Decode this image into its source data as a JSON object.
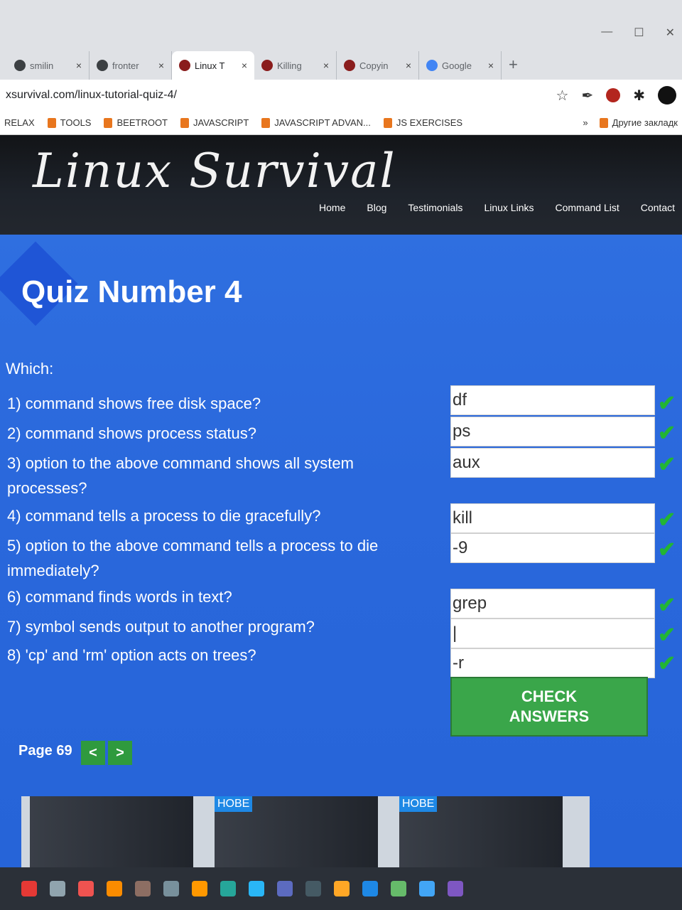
{
  "browser": {
    "tabs": [
      {
        "label": "smilin",
        "active": false
      },
      {
        "label": "fronter",
        "active": false
      },
      {
        "label": "Linux T",
        "active": true
      },
      {
        "label": "Killing",
        "active": false
      },
      {
        "label": "Copyin",
        "active": false
      },
      {
        "label": "Google",
        "active": false
      }
    ],
    "close_glyph": "×",
    "new_tab": "+",
    "url": "xsurvival.com/linux-tutorial-quiz-4/",
    "bookmarks": [
      "RELAX",
      "TOOLS",
      "BEETROOT",
      "JAVASCRIPT",
      "JAVASCRIPT ADVAN...",
      "JS EXERCISES"
    ],
    "bookmarks_more": "»",
    "other_bookmarks": "Другие закладк"
  },
  "site": {
    "logo": "Linux Survival",
    "nav": [
      "Home",
      "Blog",
      "Testimonials",
      "Linux Links",
      "Command List",
      "Contact"
    ]
  },
  "quiz": {
    "title": "Quiz Number 4",
    "intro": "Which:",
    "questions": [
      {
        "line1": "1) command shows free disk space?",
        "line2": "",
        "answer": "df"
      },
      {
        "line1": "2) command shows process status?",
        "line2": "",
        "answer": "ps"
      },
      {
        "line1": "3) option to the above command shows all system",
        "line2": "processes?",
        "answer": "aux"
      },
      {
        "line1": "4) command tells a process to die gracefully?",
        "line2": "",
        "answer": "kill"
      },
      {
        "line1": "5) option to the above command tells a process to die",
        "line2": "immediately?",
        "answer": "-9"
      },
      {
        "line1": "6) command finds words in text?",
        "line2": "",
        "answer": "grep"
      },
      {
        "line1": "7) symbol sends output to another program?",
        "line2": "",
        "answer": "|"
      },
      {
        "line1": "8) 'cp' and 'rm' option acts on trees?",
        "line2": "",
        "answer": "-r"
      }
    ],
    "check_mark": "✔",
    "check_button_line1": "CHECK",
    "check_button_line2": "ANSWERS",
    "page_label": "Page 69",
    "prev": "<",
    "next": ">"
  },
  "ads": {
    "badge": "НОВЕ"
  },
  "colors": {
    "content_bg": "#2a68dc",
    "button_green": "#3aa64a",
    "check_green": "#22b534"
  }
}
